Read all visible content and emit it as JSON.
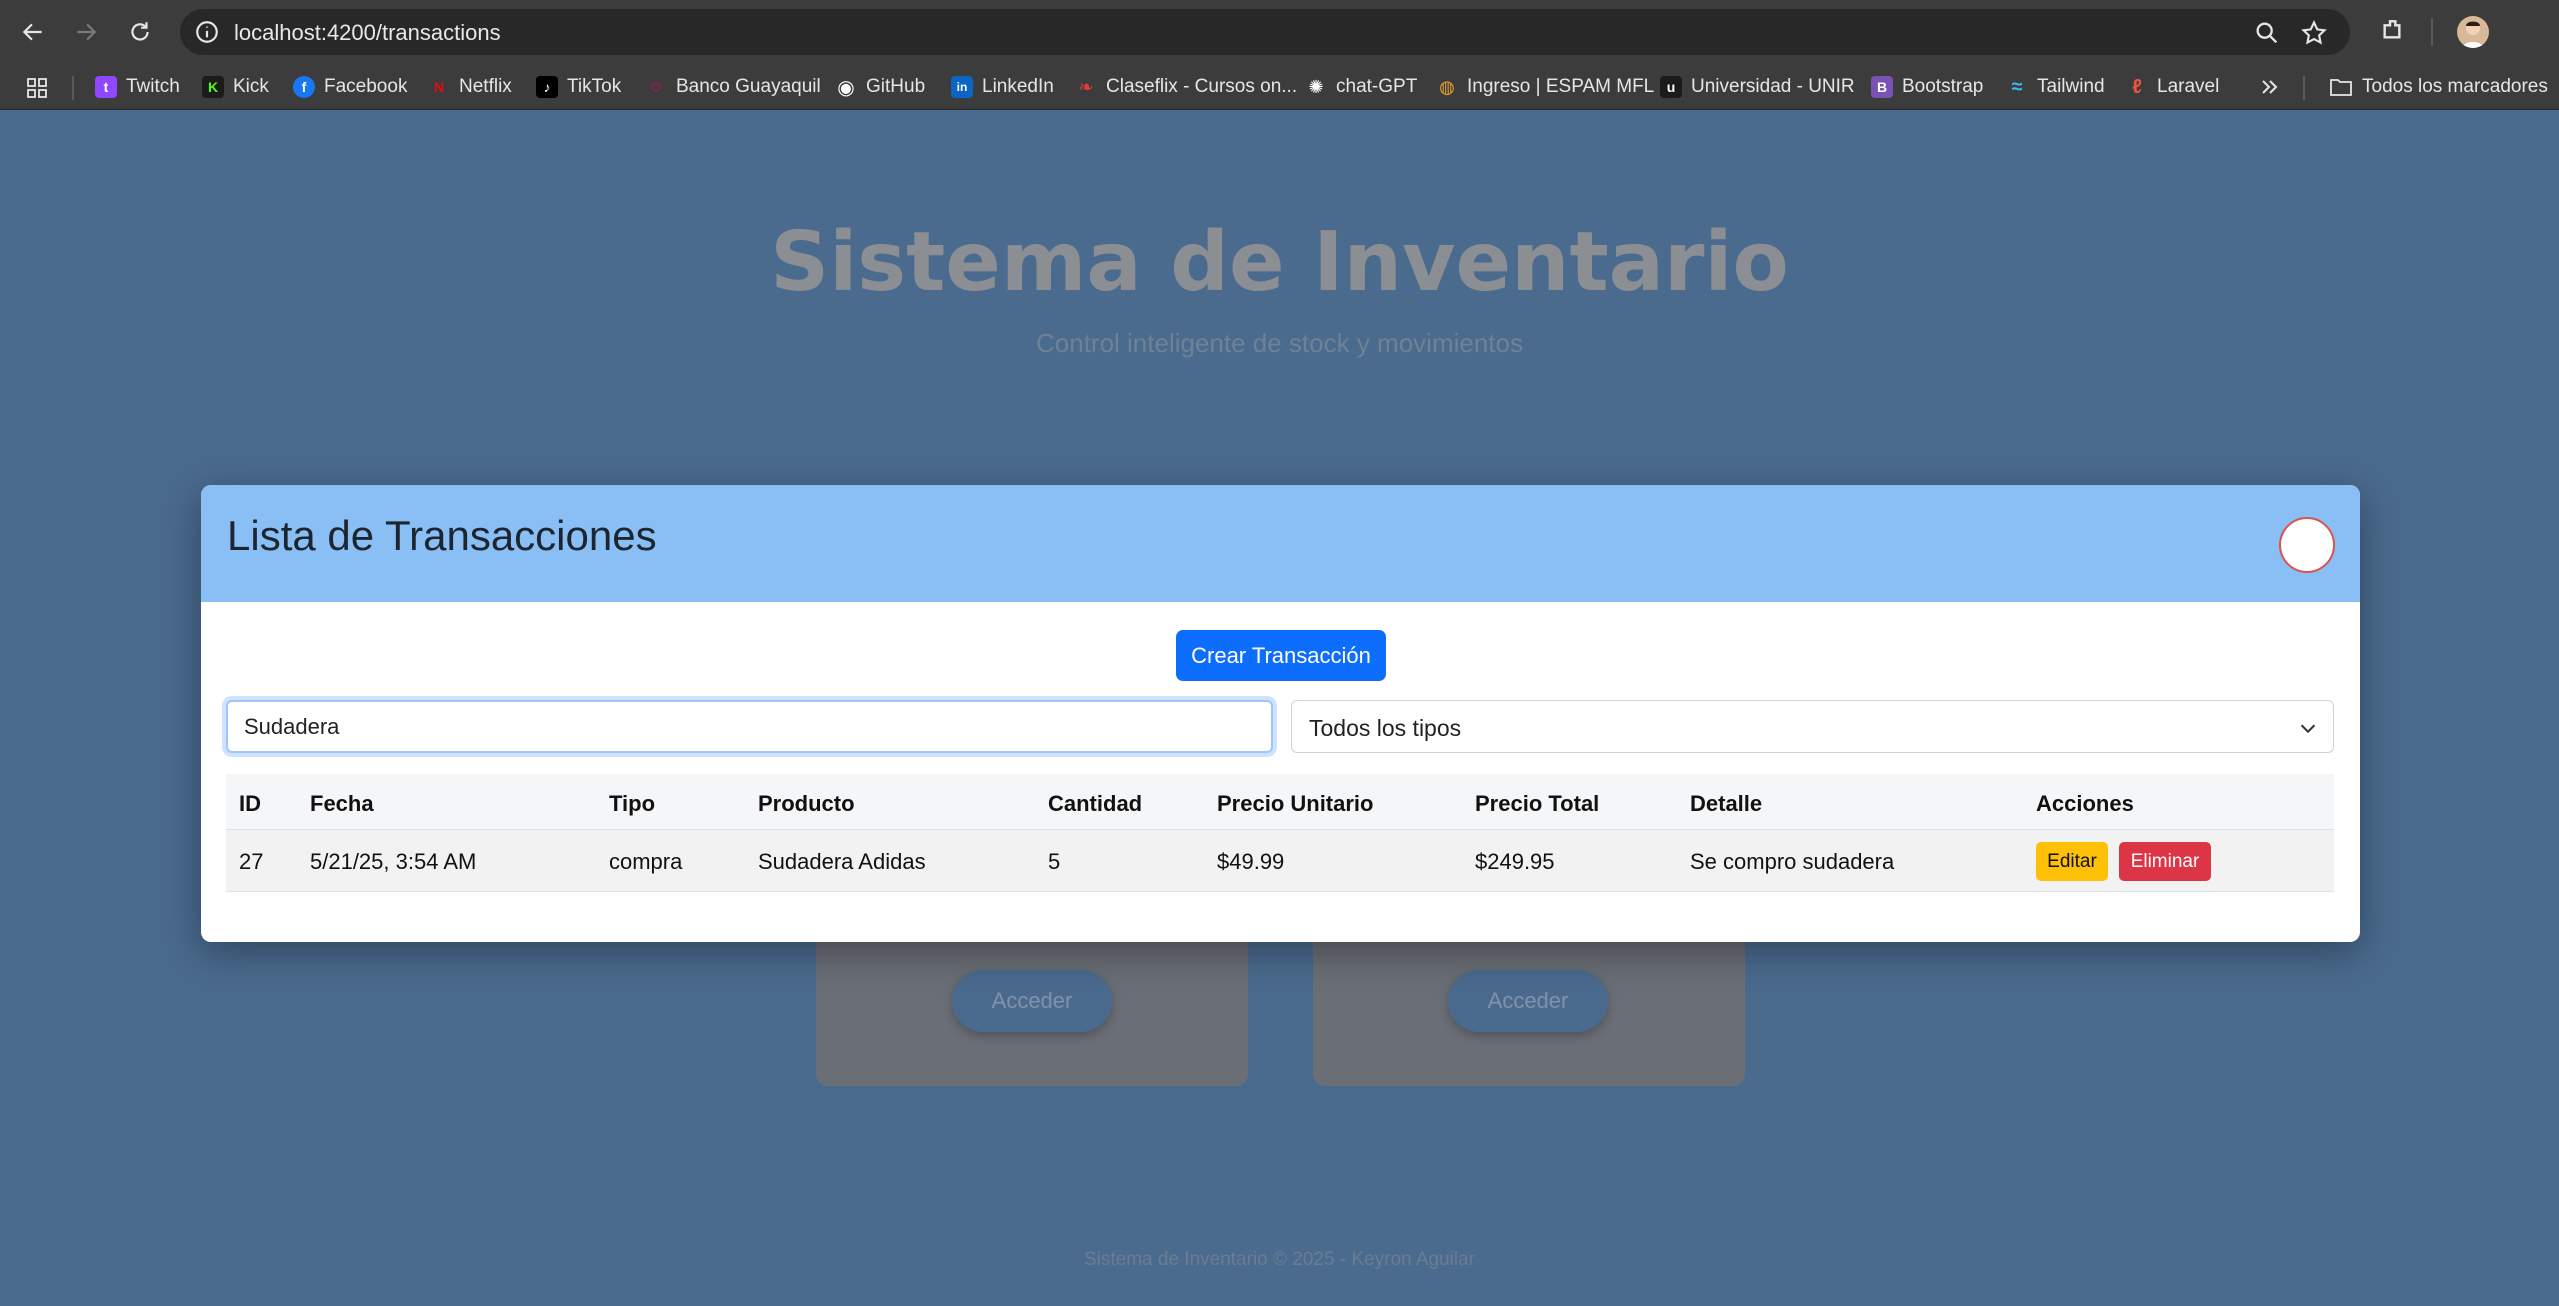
{
  "browser": {
    "url": "localhost:4200/transactions",
    "bookmarks": [
      {
        "label": "Twitch",
        "color": "#9146ff",
        "glyph": "t"
      },
      {
        "label": "Kick",
        "color": "#1b1b1b",
        "glyph": "K"
      },
      {
        "label": "Facebook",
        "color": "#1877f2",
        "glyph": "f"
      },
      {
        "label": "Netflix",
        "color": "#3c3c3c",
        "glyph": "N"
      },
      {
        "label": "TikTok",
        "color": "#000000",
        "glyph": "♪"
      },
      {
        "label": "Banco Guayaquil",
        "color": "#d6006e",
        "glyph": "○"
      },
      {
        "label": "GitHub",
        "color": "#3c3c3c",
        "glyph": "◉"
      },
      {
        "label": "LinkedIn",
        "color": "#0a66c2",
        "glyph": "in"
      },
      {
        "label": "Claseflix - Cursos on...",
        "color": "#3c3c3c",
        "glyph": "❧"
      },
      {
        "label": "chat-GPT",
        "color": "#3c3c3c",
        "glyph": "✺"
      },
      {
        "label": "Ingreso | ESPAM MFL",
        "color": "#3c3c3c",
        "glyph": "◍"
      },
      {
        "label": "Universidad - UNIR",
        "color": "#1b1b1b",
        "glyph": "u"
      },
      {
        "label": "Bootstrap",
        "color": "#7952b3",
        "glyph": "B"
      },
      {
        "label": "Tailwind",
        "color": "#3c3c3c",
        "glyph": "≈"
      },
      {
        "label": "Laravel",
        "color": "#3c3c3c",
        "glyph": "ℓ"
      }
    ],
    "all_bookmarks": "Todos los marcadores"
  },
  "background": {
    "title": "Sistema de Inventario",
    "subtitle": "Control inteligente de stock y movimientos",
    "access_label": "Acceder",
    "footer": "Sistema de Inventario © 2025 - Keyron Aguilar"
  },
  "modal": {
    "title": "Lista de Transacciones",
    "create_label": "Crear Transacción",
    "search_value": "Sudadera",
    "type_filter": "Todos los tipos",
    "columns": [
      "ID",
      "Fecha",
      "Tipo",
      "Producto",
      "Cantidad",
      "Precio Unitario",
      "Precio Total",
      "Detalle",
      "Acciones"
    ],
    "rows": [
      {
        "id": "27",
        "fecha": "5/21/25, 3:54 AM",
        "tipo": "compra",
        "producto": "Sudadera Adidas",
        "cantidad": "5",
        "precio_unitario": "$49.99",
        "precio_total": "$249.95",
        "detalle": "Se compro sudadera",
        "edit_label": "Editar",
        "delete_label": "Eliminar"
      }
    ]
  },
  "colors": {
    "overlay": "#4a6a8e",
    "modal_header": "#89bff5",
    "primary": "#0d6efd",
    "warning": "#ffc107",
    "danger": "#dc3545"
  }
}
